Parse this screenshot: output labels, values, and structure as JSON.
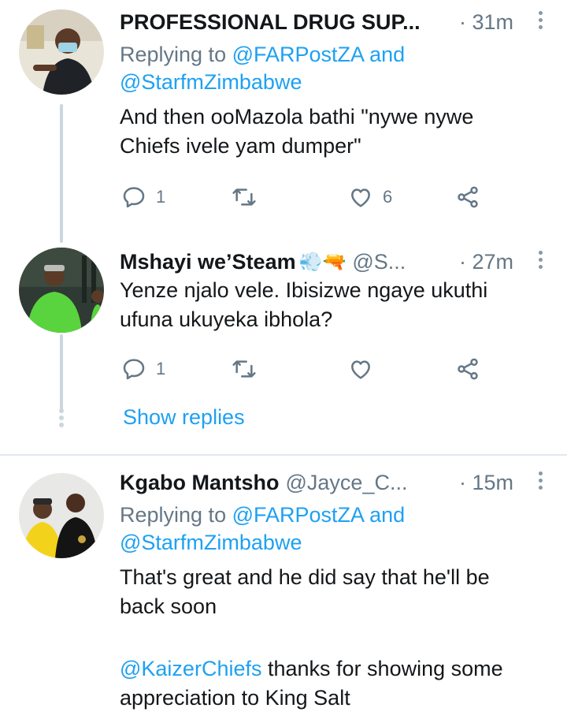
{
  "tweets": [
    {
      "name": "PROFESSIONAL DRUG SUP...",
      "handle": "",
      "time": "· 31m",
      "replying_prefix": "Replying to",
      "replying_to_1": "@FARPostZA",
      "replying_and": "and",
      "replying_to_2": "@StarfmZimbabwe",
      "text_line_1": "And then ooMazola bathi \"nywe nywe",
      "text_line_2": "Chiefs ivele yam dumper\"",
      "reply_count": "1",
      "like_count": "6"
    },
    {
      "name": "Mshayi we’Steam",
      "name_emoji": "💨🔫",
      "handle": "@S...",
      "time": "· 27m",
      "text_line_1": "Yenze njalo vele. Ibisizwe ngaye ukuthi",
      "text_line_2": "ufuna ukuyeka ibhola?",
      "reply_count": "1",
      "like_count": ""
    },
    {
      "name": "Kgabo Mantsho",
      "handle": "@Jayce_C...",
      "time": "· 15m",
      "replying_prefix": "Replying to",
      "replying_to_1": "@FARPostZA",
      "replying_and": "and",
      "replying_to_2": "@StarfmZimbabwe",
      "text_line_1": "That's great and he did say that he'll be",
      "text_line_2": "back soon",
      "mention": "@KaizerChiefs",
      "text_line_3_rest": "thanks for showing some",
      "text_line_4": "appreciation to King Salt"
    }
  ],
  "show_replies": "Show replies",
  "colors": {
    "accent": "#1da1f2",
    "secondary_text": "#657786",
    "thread_line": "#ccd6dd"
  },
  "icons": [
    "reply-icon",
    "retweet-icon",
    "like-icon",
    "share-icon",
    "more-icon"
  ]
}
